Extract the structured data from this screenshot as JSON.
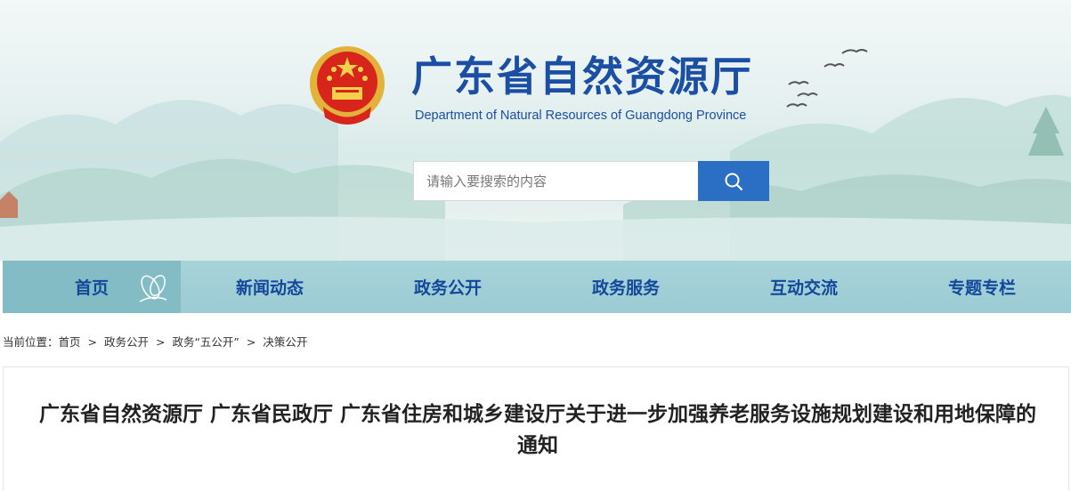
{
  "header": {
    "title": "广东省自然资源厅",
    "subtitle": "Department of Natural Resources of Guangdong Province",
    "emblem_icon": "national-emblem-icon"
  },
  "search": {
    "placeholder": "请输入要搜索的内容",
    "button_icon": "search-icon"
  },
  "nav": {
    "items": [
      {
        "label": "首页"
      },
      {
        "label": "新闻动态"
      },
      {
        "label": "政务公开"
      },
      {
        "label": "政务服务"
      },
      {
        "label": "互动交流"
      },
      {
        "label": "专题专栏"
      }
    ]
  },
  "breadcrumb": {
    "prefix": "当前位置：",
    "items": [
      "首页",
      ">",
      "政务公开",
      ">",
      "政务“五公开”",
      ">",
      "决策公开"
    ]
  },
  "article": {
    "title": "广东省自然资源厅 广东省民政厅 广东省住房和城乡建设厅关于进一步加强养老服务设施规划建设和用地保障的通知"
  },
  "colors": {
    "brand_blue": "#1a4fa3",
    "nav_bg": "#a7d3da",
    "search_button": "#2a6fc4"
  }
}
